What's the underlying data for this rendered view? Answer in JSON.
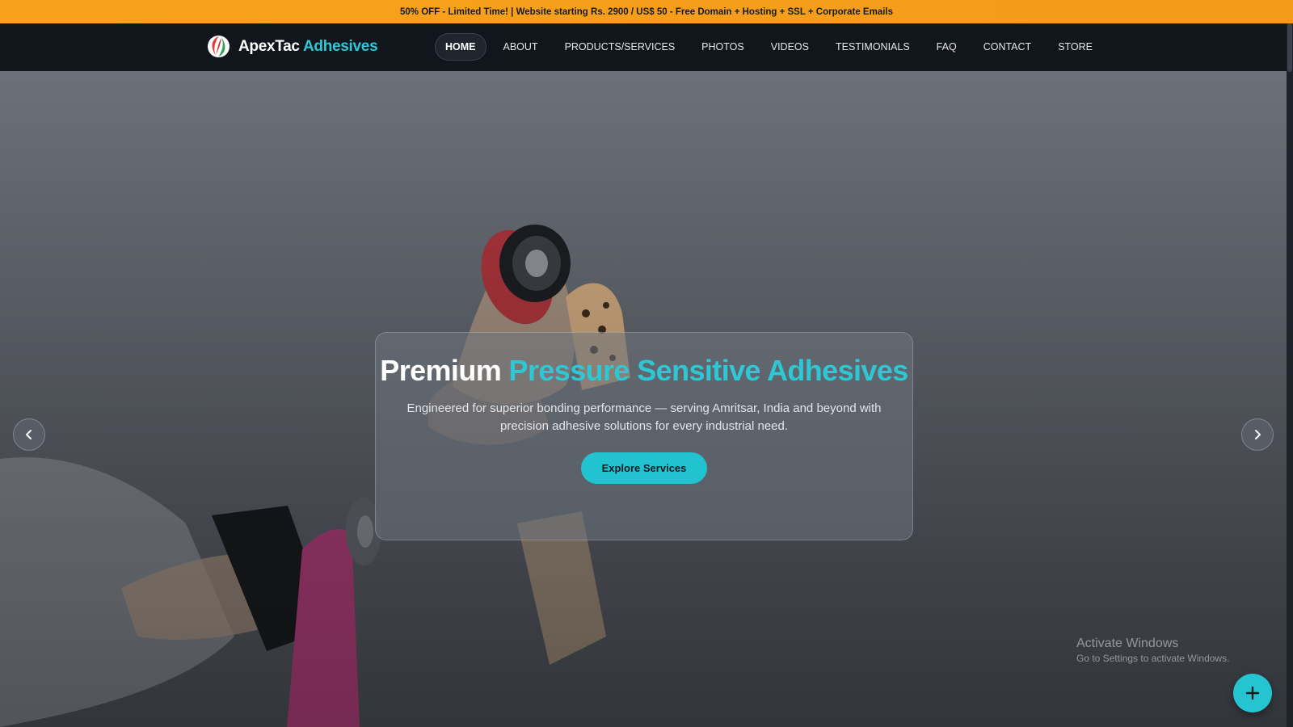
{
  "promo": {
    "text": "50% OFF - Limited Time! | Website starting Rs. 2900 / US$ 50 - Free Domain + Hosting + SSL + Corporate Emails"
  },
  "brand": {
    "name": "ApexTac",
    "accent": "Adhesives",
    "logo_icon": "red-green-leaf-logo"
  },
  "nav": {
    "items": [
      {
        "label": "HOME",
        "active": true
      },
      {
        "label": "ABOUT",
        "active": false
      },
      {
        "label": "PRODUCTS/SERVICES",
        "active": false
      },
      {
        "label": "PHOTOS",
        "active": false
      },
      {
        "label": "VIDEOS",
        "active": false
      },
      {
        "label": "TESTIMONIALS",
        "active": false
      },
      {
        "label": "FAQ",
        "active": false
      },
      {
        "label": "CONTACT",
        "active": false
      },
      {
        "label": "STORE",
        "active": false
      }
    ]
  },
  "hero": {
    "title_white": "Premium",
    "title_accent": "Pressure Sensitive Adhesives",
    "subtitle": "Engineered for superior bonding performance — serving Amritsar, India and beyond with precision adhesive solutions for every industrial need.",
    "cta_label": "Explore Services",
    "prev_icon": "chevron-left-icon",
    "next_icon": "chevron-right-icon"
  },
  "watermark": {
    "title": "Activate Windows",
    "subtitle": "Go to Settings to activate Windows."
  },
  "fab": {
    "icon": "plus-icon"
  },
  "colors": {
    "promo_bg": "#f7a21d",
    "nav_bg": "#11161c",
    "accent": "#2ec7d4",
    "cta_bg": "#22c3d0"
  }
}
